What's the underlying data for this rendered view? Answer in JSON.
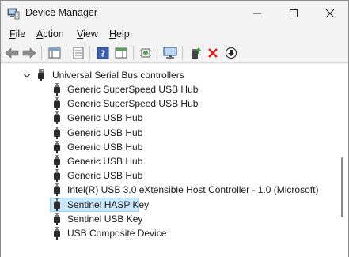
{
  "window": {
    "title": "Device Manager"
  },
  "menu": {
    "file": "File",
    "action": "Action",
    "view": "View",
    "help": "Help"
  },
  "tree": {
    "category": "Universal Serial Bus controllers",
    "items": [
      "Generic SuperSpeed USB Hub",
      "Generic SuperSpeed USB Hub",
      "Generic USB Hub",
      "Generic USB Hub",
      "Generic USB Hub",
      "Generic USB Hub",
      "Generic USB Hub",
      "Intel(R) USB 3.0 eXtensible Host Controller - 1.0 (Microsoft)",
      "Sentinel HASP Key",
      "Sentinel USB Key",
      "USB Composite Device"
    ],
    "selected_index": 8
  },
  "colors": {
    "selection": "#cce8ff",
    "selection_border": "#99d1ff",
    "uninstall_red": "#e02020"
  }
}
